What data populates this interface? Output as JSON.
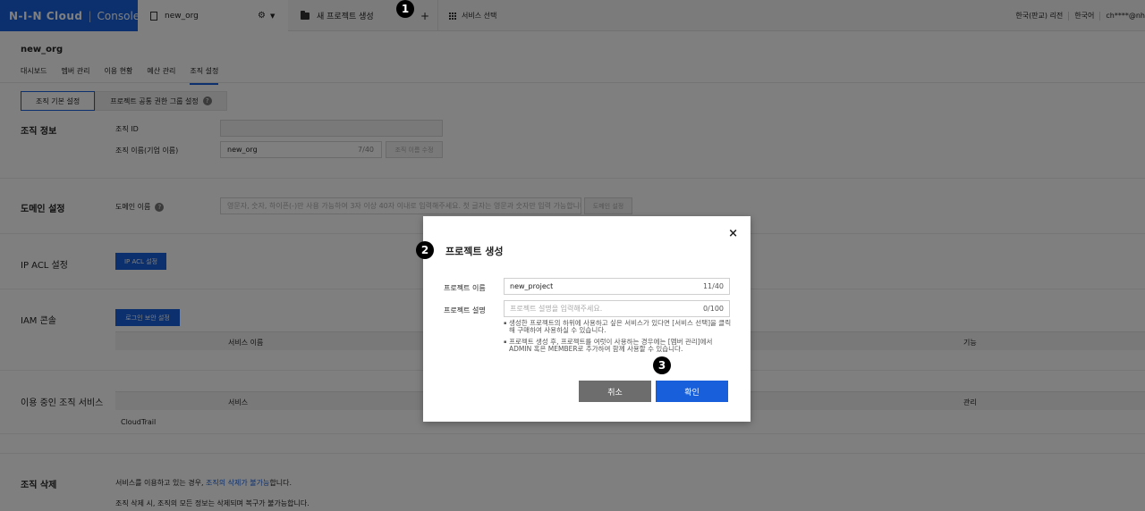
{
  "topbar": {
    "brand": "N-I-N Cloud",
    "console": "Console",
    "org_name": "new_org",
    "new_project": "새 프로젝트 생성",
    "plus": "+",
    "service_select": "서비스 선택",
    "region": "한국(판교) 리전",
    "language": "한국어",
    "user": "ch****@nh"
  },
  "markers": {
    "m1": "1",
    "m2": "2",
    "m3": "3"
  },
  "page": {
    "title": "new_org",
    "nav": [
      "대시보드",
      "멤버 관리",
      "이용 현황",
      "예산 관리",
      "조직 설정"
    ],
    "subtabs": [
      "조직 기본 설정",
      "프로젝트 공통 권한 그룹 설정"
    ],
    "help": "?"
  },
  "org_info": {
    "title": "조직 정보",
    "id_label": "조직 ID",
    "name_label": "조직 이름(기업 이름)",
    "name_value": "new_org",
    "name_count": "7/40",
    "name_edit_button": "조직 이름 수정"
  },
  "domain": {
    "title": "도메인 설정",
    "label": "도메인 이름",
    "placeholder": "영문자, 숫자, 하이픈(-)만 사용 가능하여 3자 이상 40자 이내로 입력해주세요. 첫 글자는 영문과 숫자만 입력 가능합니다.",
    "button": "도메인 설정"
  },
  "ip_acl": {
    "title": "IP ACL 설정",
    "button": "IP ACL 설정"
  },
  "iam": {
    "title": "IAM 콘솔",
    "button": "로그인 보안 설정",
    "col_service": "서비스 이름",
    "col_func": "기능"
  },
  "services": {
    "title": "이용 중인 조직 서비스",
    "col_service": "서비스",
    "col_manage": "관리",
    "row1": "CloudTrail"
  },
  "delete": {
    "title": "조직 삭제",
    "line1_pre": "서비스를 이용하고 있는 경우, ",
    "line1_link": "조직의 삭제가 불가능",
    "line1_post": "합니다.",
    "line2": "조직 삭제 시, 조직의 모든 정보는 삭제되며 복구가 불가능합니다."
  },
  "modal": {
    "close": "×",
    "title": "프로젝트 생성",
    "name_label": "프로젝트 이름",
    "name_value": "new_project",
    "name_count": "11/40",
    "desc_label": "프로젝트 설명",
    "desc_placeholder": "프로젝트 설명을 입력해주세요.",
    "desc_count": "0/100",
    "note1": "생성한 프로젝트의 하위에 사용하고 싶은 서비스가 있다면 [서비스 선택]을 클릭해 구매하여 사용하실 수 있습니다.",
    "note2": "프로젝트 생성 후, 프로젝트를 여럿이 사용하는 경우에는 [멤버 관리]에서 ADMIN 혹은 MEMBER로 추가하여 함께 사용할 수 있습니다.",
    "cancel": "취소",
    "confirm": "확인"
  }
}
